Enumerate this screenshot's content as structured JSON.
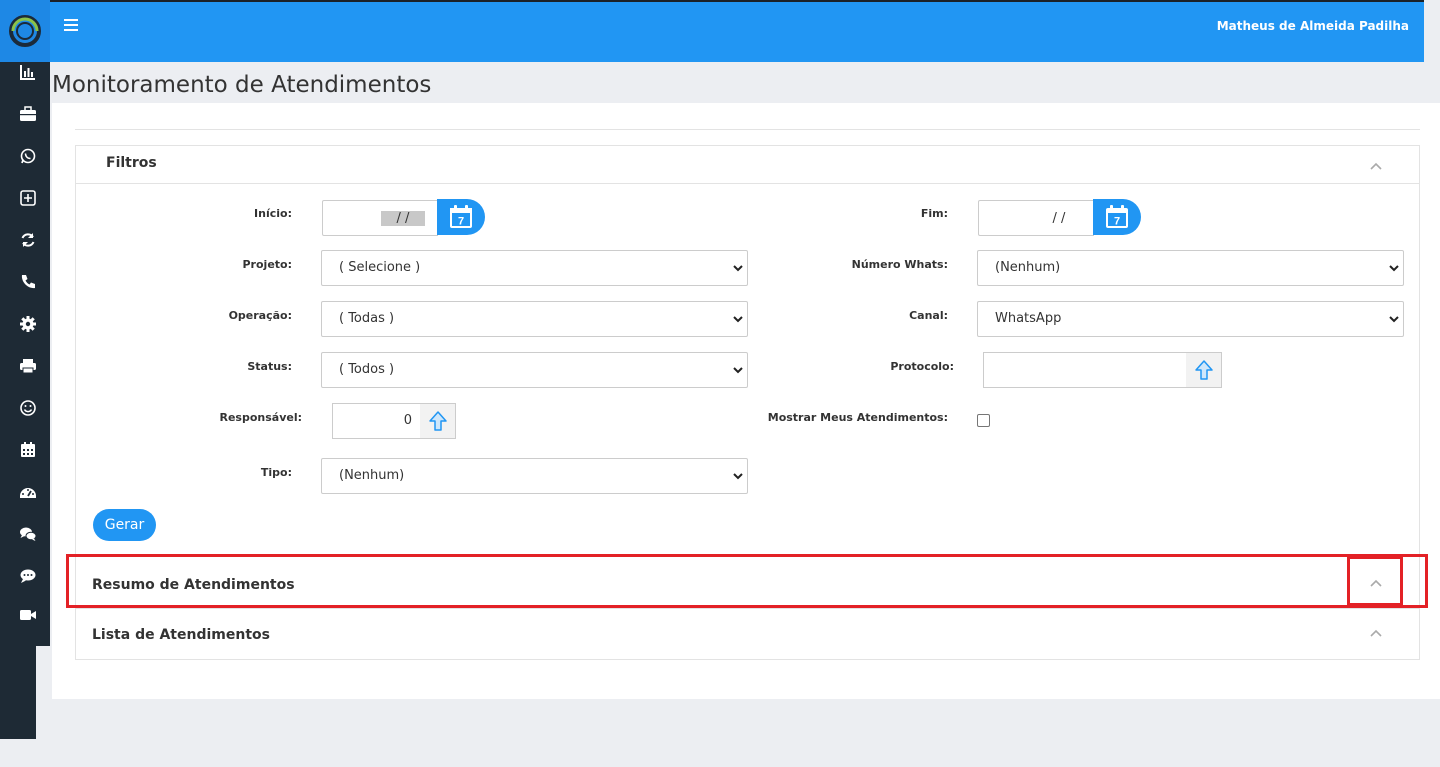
{
  "header": {
    "user_name": "Matheus de Almeida Padilha",
    "menu_icon": "hamburger-icon",
    "brand_color": "#2196f3"
  },
  "sidebar": {
    "items": [
      {
        "icon": "bar-chart-icon"
      },
      {
        "icon": "briefcase-icon"
      },
      {
        "icon": "whatsapp-icon"
      },
      {
        "icon": "plus-square-icon"
      },
      {
        "icon": "refresh-icon"
      },
      {
        "icon": "phone-icon"
      },
      {
        "icon": "gear-icon"
      },
      {
        "icon": "printer-icon"
      },
      {
        "icon": "smile-icon"
      },
      {
        "icon": "calendar-icon"
      },
      {
        "icon": "dashboard-icon"
      },
      {
        "icon": "comments-icon"
      },
      {
        "icon": "comment-dots-icon"
      },
      {
        "icon": "video-icon"
      }
    ]
  },
  "page": {
    "title": "Monitoramento de Atendimentos"
  },
  "filters": {
    "title": "Filtros",
    "inicio_label": "Início:",
    "inicio_value": "/ /",
    "fim_label": "Fim:",
    "fim_value": "/ /",
    "projeto_label": "Projeto:",
    "projeto_value": "( Selecione )",
    "numero_whats_label": "Número Whats:",
    "numero_whats_value": "(Nenhum)",
    "operacao_label": "Operação:",
    "operacao_value": "( Todas )",
    "canal_label": "Canal:",
    "canal_value": "WhatsApp",
    "status_label": "Status:",
    "status_value": "( Todos )",
    "protocolo_label": "Protocolo:",
    "protocolo_value": "",
    "responsavel_label": "Responsável:",
    "responsavel_value": "0",
    "mostrar_label": "Mostrar Meus Atendimentos:",
    "mostrar_checked": false,
    "tipo_label": "Tipo:",
    "tipo_value": "(Nenhum)",
    "gerar_label": "Gerar",
    "calendar_day": "7"
  },
  "sections": {
    "resumo_title": "Resumo de Atendimentos",
    "lista_title": "Lista de Atendimentos"
  }
}
